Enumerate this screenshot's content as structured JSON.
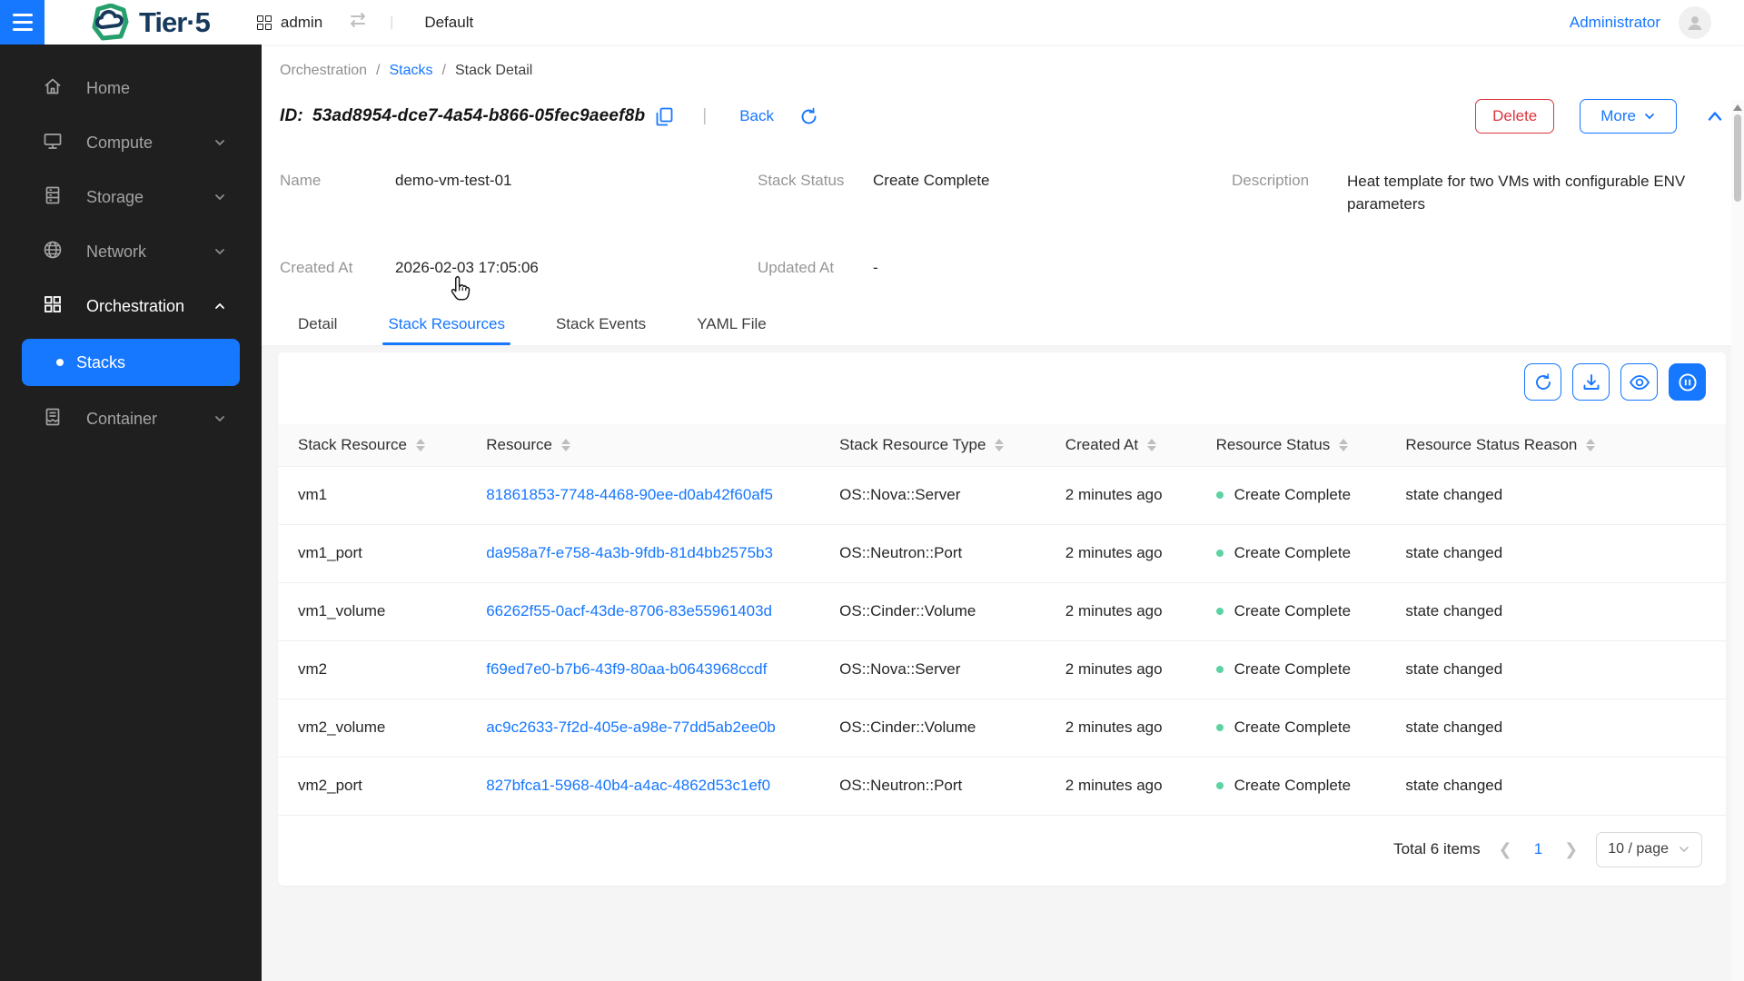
{
  "colors": {
    "primary": "#1677ff",
    "danger": "#d9363e",
    "status_dot_green": "#5cd3a2",
    "sidebar_bg": "#1f1f1f",
    "logo_navy": "#17395c",
    "logo_green": "#27a06d"
  },
  "header": {
    "logo_text": "Tier·5",
    "project": "admin",
    "region": "Default",
    "user": "Administrator"
  },
  "sidebar": {
    "items": [
      {
        "label": "Home"
      },
      {
        "label": "Compute"
      },
      {
        "label": "Storage"
      },
      {
        "label": "Network"
      },
      {
        "label": "Orchestration"
      },
      {
        "label": "Container"
      }
    ],
    "submenu": {
      "label": "Stacks"
    }
  },
  "breadcrumb": {
    "separator": "/",
    "items": [
      {
        "label": "Orchestration"
      },
      {
        "label": "Stacks"
      },
      {
        "label": "Stack Detail"
      }
    ]
  },
  "detail_header": {
    "id_label": "ID:",
    "id_value": "53ad8954-dce7-4a54-b866-05fec9aeef8b",
    "divider": "|",
    "back_label": "Back",
    "delete_label": "Delete",
    "more_label": "More",
    "fields": {
      "name_label": "Name",
      "name_value": "demo-vm-test-01",
      "status_label": "Stack Status",
      "status_value": "Create Complete",
      "description_label": "Description",
      "description_value": "Heat template for two VMs with configurable ENV parameters",
      "created_label": "Created At",
      "created_value": "2026-02-03 17:05:06",
      "updated_label": "Updated At",
      "updated_value": "-"
    }
  },
  "tabs": [
    {
      "label": "Detail"
    },
    {
      "label": "Stack Resources"
    },
    {
      "label": "Stack Events"
    },
    {
      "label": "YAML File"
    }
  ],
  "table": {
    "columns": [
      "Stack Resource",
      "Resource",
      "Stack Resource Type",
      "Created At",
      "Resource Status",
      "Resource Status Reason"
    ],
    "rows": [
      {
        "stack_resource": "vm1",
        "resource": "81861853-7748-4468-90ee-d0ab42f60af5",
        "type": "OS::Nova::Server",
        "created": "2 minutes ago",
        "status": "Create Complete",
        "reason": "state changed"
      },
      {
        "stack_resource": "vm1_port",
        "resource": "da958a7f-e758-4a3b-9fdb-81d4bb2575b3",
        "type": "OS::Neutron::Port",
        "created": "2 minutes ago",
        "status": "Create Complete",
        "reason": "state changed"
      },
      {
        "stack_resource": "vm1_volume",
        "resource": "66262f55-0acf-43de-8706-83e55961403d",
        "type": "OS::Cinder::Volume",
        "created": "2 minutes ago",
        "status": "Create Complete",
        "reason": "state changed"
      },
      {
        "stack_resource": "vm2",
        "resource": "f69ed7e0-b7b6-43f9-80aa-b0643968ccdf",
        "type": "OS::Nova::Server",
        "created": "2 minutes ago",
        "status": "Create Complete",
        "reason": "state changed"
      },
      {
        "stack_resource": "vm2_volume",
        "resource": "ac9c2633-7f2d-405e-a98e-77dd5ab2ee0b",
        "type": "OS::Cinder::Volume",
        "created": "2 minutes ago",
        "status": "Create Complete",
        "reason": "state changed"
      },
      {
        "stack_resource": "vm2_port",
        "resource": "827bfca1-5968-40b4-a4ac-4862d53c1ef0",
        "type": "OS::Neutron::Port",
        "created": "2 minutes ago",
        "status": "Create Complete",
        "reason": "state changed"
      }
    ]
  },
  "pagination": {
    "total_text": "Total 6 items",
    "current_page": "1",
    "page_size": "10 / page"
  }
}
